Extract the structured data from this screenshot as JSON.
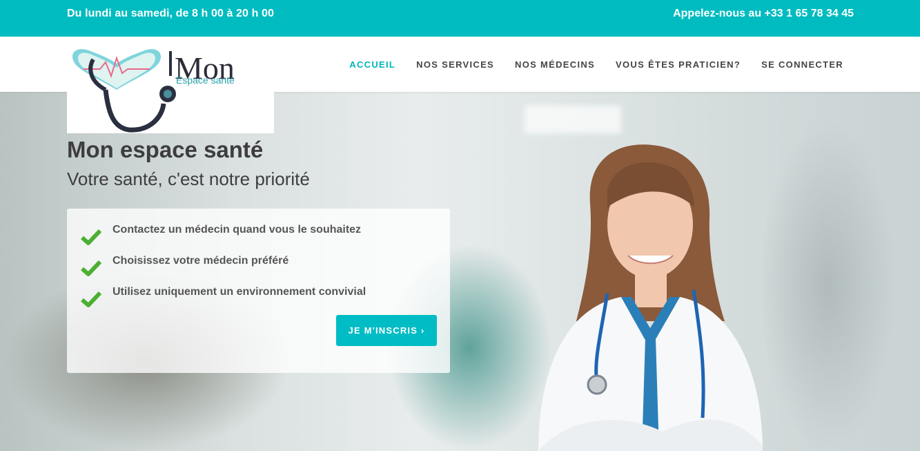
{
  "topbar": {
    "hours": "Du lundi au samedi, de 8 h 00 à 20 h 00",
    "phone": "Appelez-nous au +33 1 65 78 34 45"
  },
  "logo": {
    "brand": "Mon",
    "subtitle": "Espace santé"
  },
  "nav": {
    "items": [
      {
        "label": "ACCUEIL",
        "active": true
      },
      {
        "label": "NOS SERVICES",
        "active": false
      },
      {
        "label": "NOS MÉDECINS",
        "active": false
      },
      {
        "label": "VOUS ÊTES PRATICIEN?",
        "active": false
      },
      {
        "label": "SE CONNECTER",
        "active": false
      }
    ]
  },
  "hero": {
    "title": "Mon espace santé",
    "subtitle": "Votre santé, c'est notre priorité",
    "features": [
      "Contactez un médecin quand vous le souhaitez",
      "Choisissez votre médecin préféré",
      "Utilisez uniquement un environnement convivial"
    ],
    "cta_label": "JE M'INSCRIS ›"
  },
  "colors": {
    "accent": "#00bcc0",
    "check": "#4caf32",
    "text": "#3d3d40"
  },
  "icons": {
    "feature_icon": "check-icon",
    "logo_icon": "stethoscope-heart-icon"
  }
}
